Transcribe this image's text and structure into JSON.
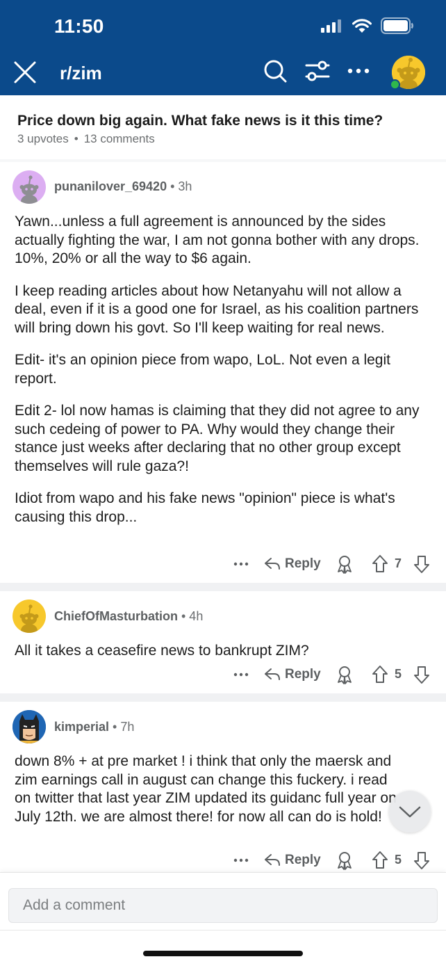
{
  "status": {
    "time": "11:50"
  },
  "header": {
    "subreddit": "r/zim"
  },
  "post": {
    "title": "Price down big again. What fake news is it this time?",
    "upvotes": "3 upvotes",
    "dot": "•",
    "comments": "13 comments"
  },
  "comments": [
    {
      "author": "punanilover_69420",
      "age": " • 3h",
      "paragraphs": [
        "Yawn...unless a full agreement is announced by the sides actually fighting the war, I am not gonna bother with any drops. 10%, 20% or all the way to $6 again.",
        "I keep reading articles about how Netanyahu will not allow a deal, even if it is a good one for Israel, as his coalition partners will bring down his govt. So I'll keep waiting for real news.",
        "Edit- it's an opinion piece from wapo, LoL. Not even a legit report.",
        "Edit 2- lol now hamas is claiming that they did not agree to any such cedeing of power to PA. Why would they change their stance just weeks after declaring that no other group except themselves will rule gaza?!",
        "Idiot from wapo and his fake news \"opinion\" piece is what's causing this drop..."
      ],
      "reply": "Reply",
      "score": "7"
    },
    {
      "author": "ChiefOfMasturbation",
      "age": " • 4h",
      "paragraphs": [
        "All it takes a ceasefire news to bankrupt ZIM?"
      ],
      "reply": "Reply",
      "score": "5"
    },
    {
      "author": "kimperial",
      "age": " • 7h",
      "paragraphs": [
        "down 8% + at pre market ! i think that only the maersk and zim earnings call in august can change this fuckery. i read on twitter that last year ZIM updated its guidanc full year on July 12th. we are almost there! for now all can do is hold!"
      ],
      "reply": "Reply",
      "score": "5"
    }
  ],
  "composer": {
    "placeholder": "Add a comment"
  },
  "colors": {
    "header": "#0b4a8b",
    "text": "#1c1c1c",
    "muted": "#6b6e70",
    "avatar_yellow": "#f7c82c",
    "avatar_purple": "#dcaef2",
    "online": "#2fb84c"
  }
}
